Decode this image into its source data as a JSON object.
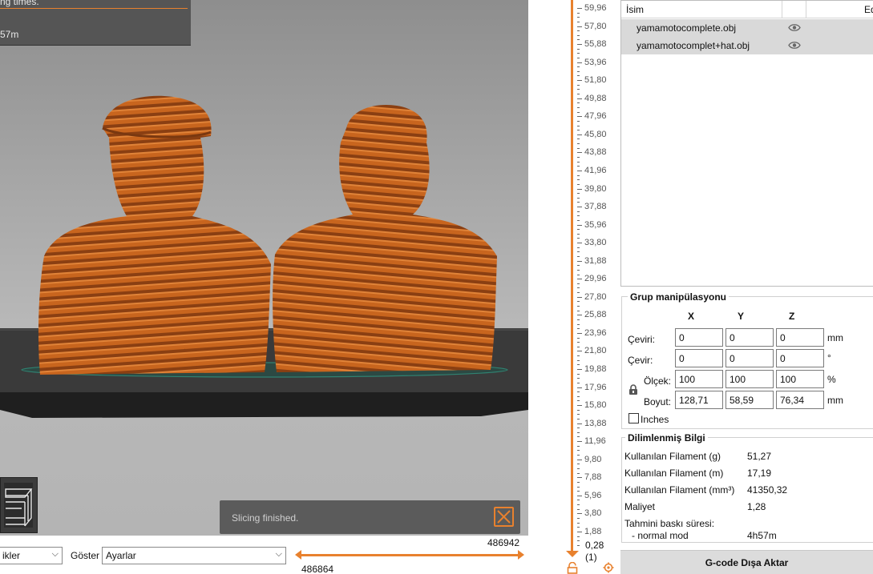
{
  "viewport": {
    "notification_top": {
      "line1": "ng times.",
      "line2": "57m"
    },
    "slicing_status": "Slicing finished."
  },
  "bottom_bar": {
    "view_combo_value": "ikler",
    "show_label": "Göster",
    "show_combo_value": "Ayarlar",
    "range_start": "486864",
    "range_end": "486942"
  },
  "layer_slider": {
    "ticks": [
      "59,96",
      "57,80",
      "55,88",
      "53,96",
      "51,80",
      "49,88",
      "47,96",
      "45,80",
      "43,88",
      "41,96",
      "39,80",
      "37,88",
      "35,96",
      "33,80",
      "31,88",
      "29,96",
      "27,80",
      "25,88",
      "23,96",
      "21,80",
      "19,88",
      "17,96",
      "15,80",
      "13,88",
      "11,96",
      "9,80",
      "7,88",
      "5,96",
      "3,80",
      "1,88"
    ],
    "bottom_value": "0,28",
    "bottom_index": "(1)"
  },
  "object_list": {
    "columns": {
      "name": "İsim",
      "edit": "Ed"
    },
    "items": [
      {
        "name": "yamamotocomplete.obj",
        "visibility_icon": "eye-icon"
      },
      {
        "name": "yamamotocomplet+hat.obj",
        "visibility_icon": "eye-icon"
      }
    ]
  },
  "group_manipulation": {
    "title": "Grup manipülasyonu",
    "axes": [
      "X",
      "Y",
      "Z"
    ],
    "rows": [
      {
        "label": "Çeviri:",
        "values": [
          "0",
          "0",
          "0"
        ],
        "unit": "mm"
      },
      {
        "label": "Çevir:",
        "values": [
          "0",
          "0",
          "0"
        ],
        "unit": "°"
      },
      {
        "label": "Ölçek:",
        "values": [
          "100",
          "100",
          "100"
        ],
        "unit": "%"
      },
      {
        "label": "Boyut:",
        "values": [
          "128,71",
          "58,59",
          "76,34"
        ],
        "unit": "mm"
      }
    ],
    "inches_label": "Inches",
    "inches_checked": false
  },
  "sliced_info": {
    "title": "Dilimlenmiş Bilgi",
    "rows": [
      {
        "label": "Kullanılan Filament (g)",
        "value": "51,27"
      },
      {
        "label": "Kullanılan Filament (m)",
        "value": "17,19"
      },
      {
        "label": "Kullanılan Filament (mm³)",
        "value": "41350,32"
      },
      {
        "label": "Maliyet",
        "value": "1,28"
      },
      {
        "label": "Tahmini baskı süresi:",
        "value": ""
      },
      {
        "label": "- normal mod",
        "value": "4h57m"
      }
    ]
  },
  "export_button": "G-code Dışa Aktar",
  "colors": {
    "accent": "#e8812e",
    "model": "#c8651e",
    "viewport_bg": "#a9a9a9"
  }
}
